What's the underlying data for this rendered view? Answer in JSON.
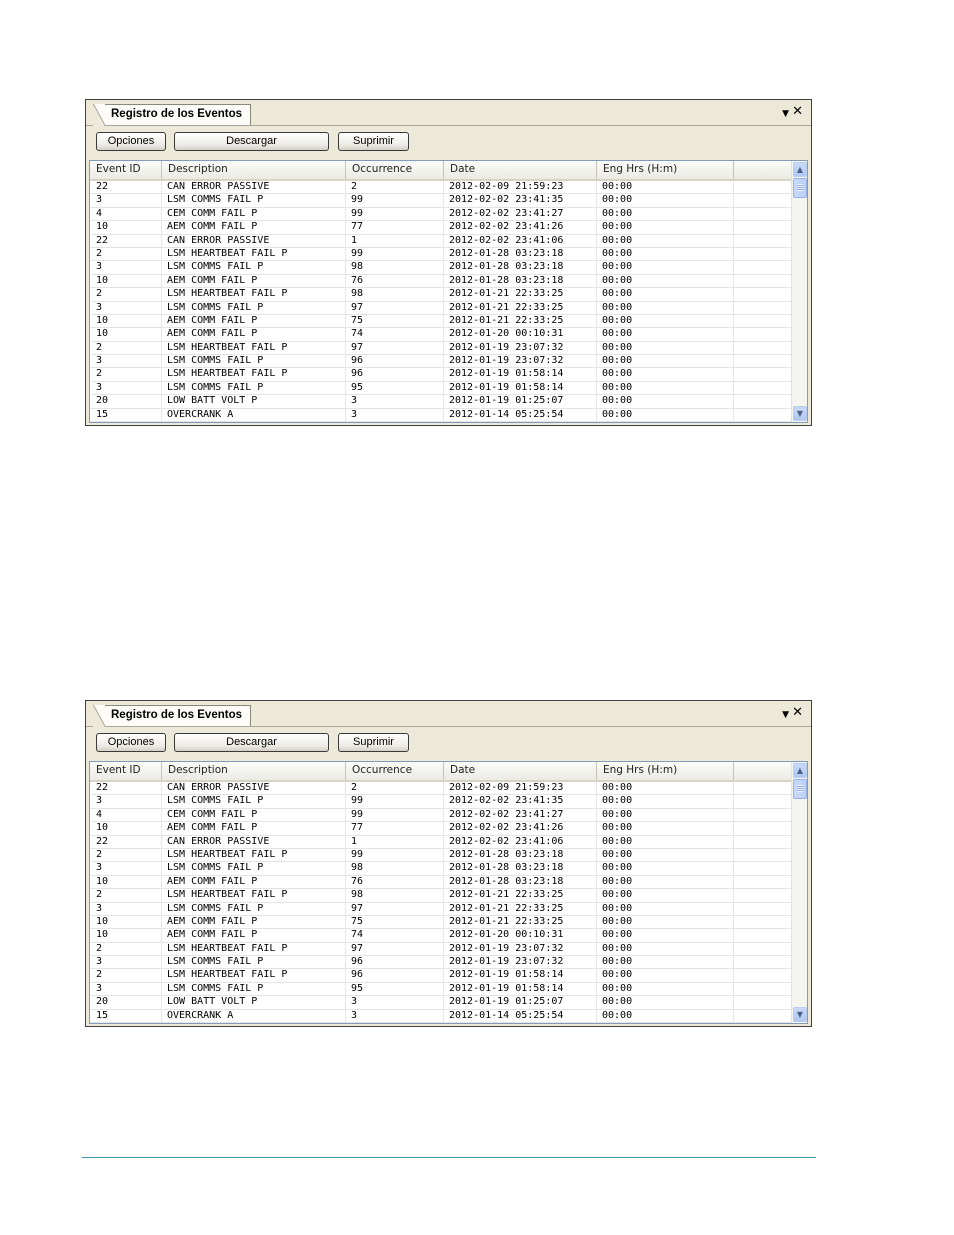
{
  "panel": {
    "tab_title": "Registro de los Eventos",
    "dropdown_glyph": "▼",
    "close_glyph": "✕",
    "buttons": {
      "opciones": "Opciones",
      "descargar": "Descargar",
      "suprimir": "Suprimir"
    },
    "columns": [
      "Event ID",
      "Description",
      "Occurrence",
      "Date",
      "Eng Hrs (H:m)"
    ],
    "rows": [
      [
        "22",
        "CAN ERROR PASSIVE",
        "2",
        "2012-02-09 21:59:23",
        "00:00"
      ],
      [
        "3",
        "LSM COMMS FAIL P",
        "99",
        "2012-02-02 23:41:35",
        "00:00"
      ],
      [
        "4",
        "CEM COMM FAIL P",
        "99",
        "2012-02-02 23:41:27",
        "00:00"
      ],
      [
        "10",
        "AEM COMM FAIL P",
        "77",
        "2012-02-02 23:41:26",
        "00:00"
      ],
      [
        "22",
        "CAN ERROR PASSIVE",
        "1",
        "2012-02-02 23:41:06",
        "00:00"
      ],
      [
        "2",
        "LSM HEARTBEAT FAIL P",
        "99",
        "2012-01-28 03:23:18",
        "00:00"
      ],
      [
        "3",
        "LSM COMMS FAIL P",
        "98",
        "2012-01-28 03:23:18",
        "00:00"
      ],
      [
        "10",
        "AEM COMM FAIL P",
        "76",
        "2012-01-28 03:23:18",
        "00:00"
      ],
      [
        "2",
        "LSM HEARTBEAT FAIL P",
        "98",
        "2012-01-21 22:33:25",
        "00:00"
      ],
      [
        "3",
        "LSM COMMS FAIL P",
        "97",
        "2012-01-21 22:33:25",
        "00:00"
      ],
      [
        "10",
        "AEM COMM FAIL P",
        "75",
        "2012-01-21 22:33:25",
        "00:00"
      ],
      [
        "10",
        "AEM COMM FAIL P",
        "74",
        "2012-01-20 00:10:31",
        "00:00"
      ],
      [
        "2",
        "LSM HEARTBEAT FAIL P",
        "97",
        "2012-01-19 23:07:32",
        "00:00"
      ],
      [
        "3",
        "LSM COMMS FAIL P",
        "96",
        "2012-01-19 23:07:32",
        "00:00"
      ],
      [
        "2",
        "LSM HEARTBEAT FAIL P",
        "96",
        "2012-01-19 01:58:14",
        "00:00"
      ],
      [
        "3",
        "LSM COMMS FAIL P",
        "95",
        "2012-01-19 01:58:14",
        "00:00"
      ],
      [
        "20",
        "LOW BATT VOLT P",
        "3",
        "2012-01-19 01:25:07",
        "00:00"
      ],
      [
        "15",
        "OVERCRANK A",
        "3",
        "2012-01-14 05:25:54",
        "00:00"
      ]
    ]
  }
}
